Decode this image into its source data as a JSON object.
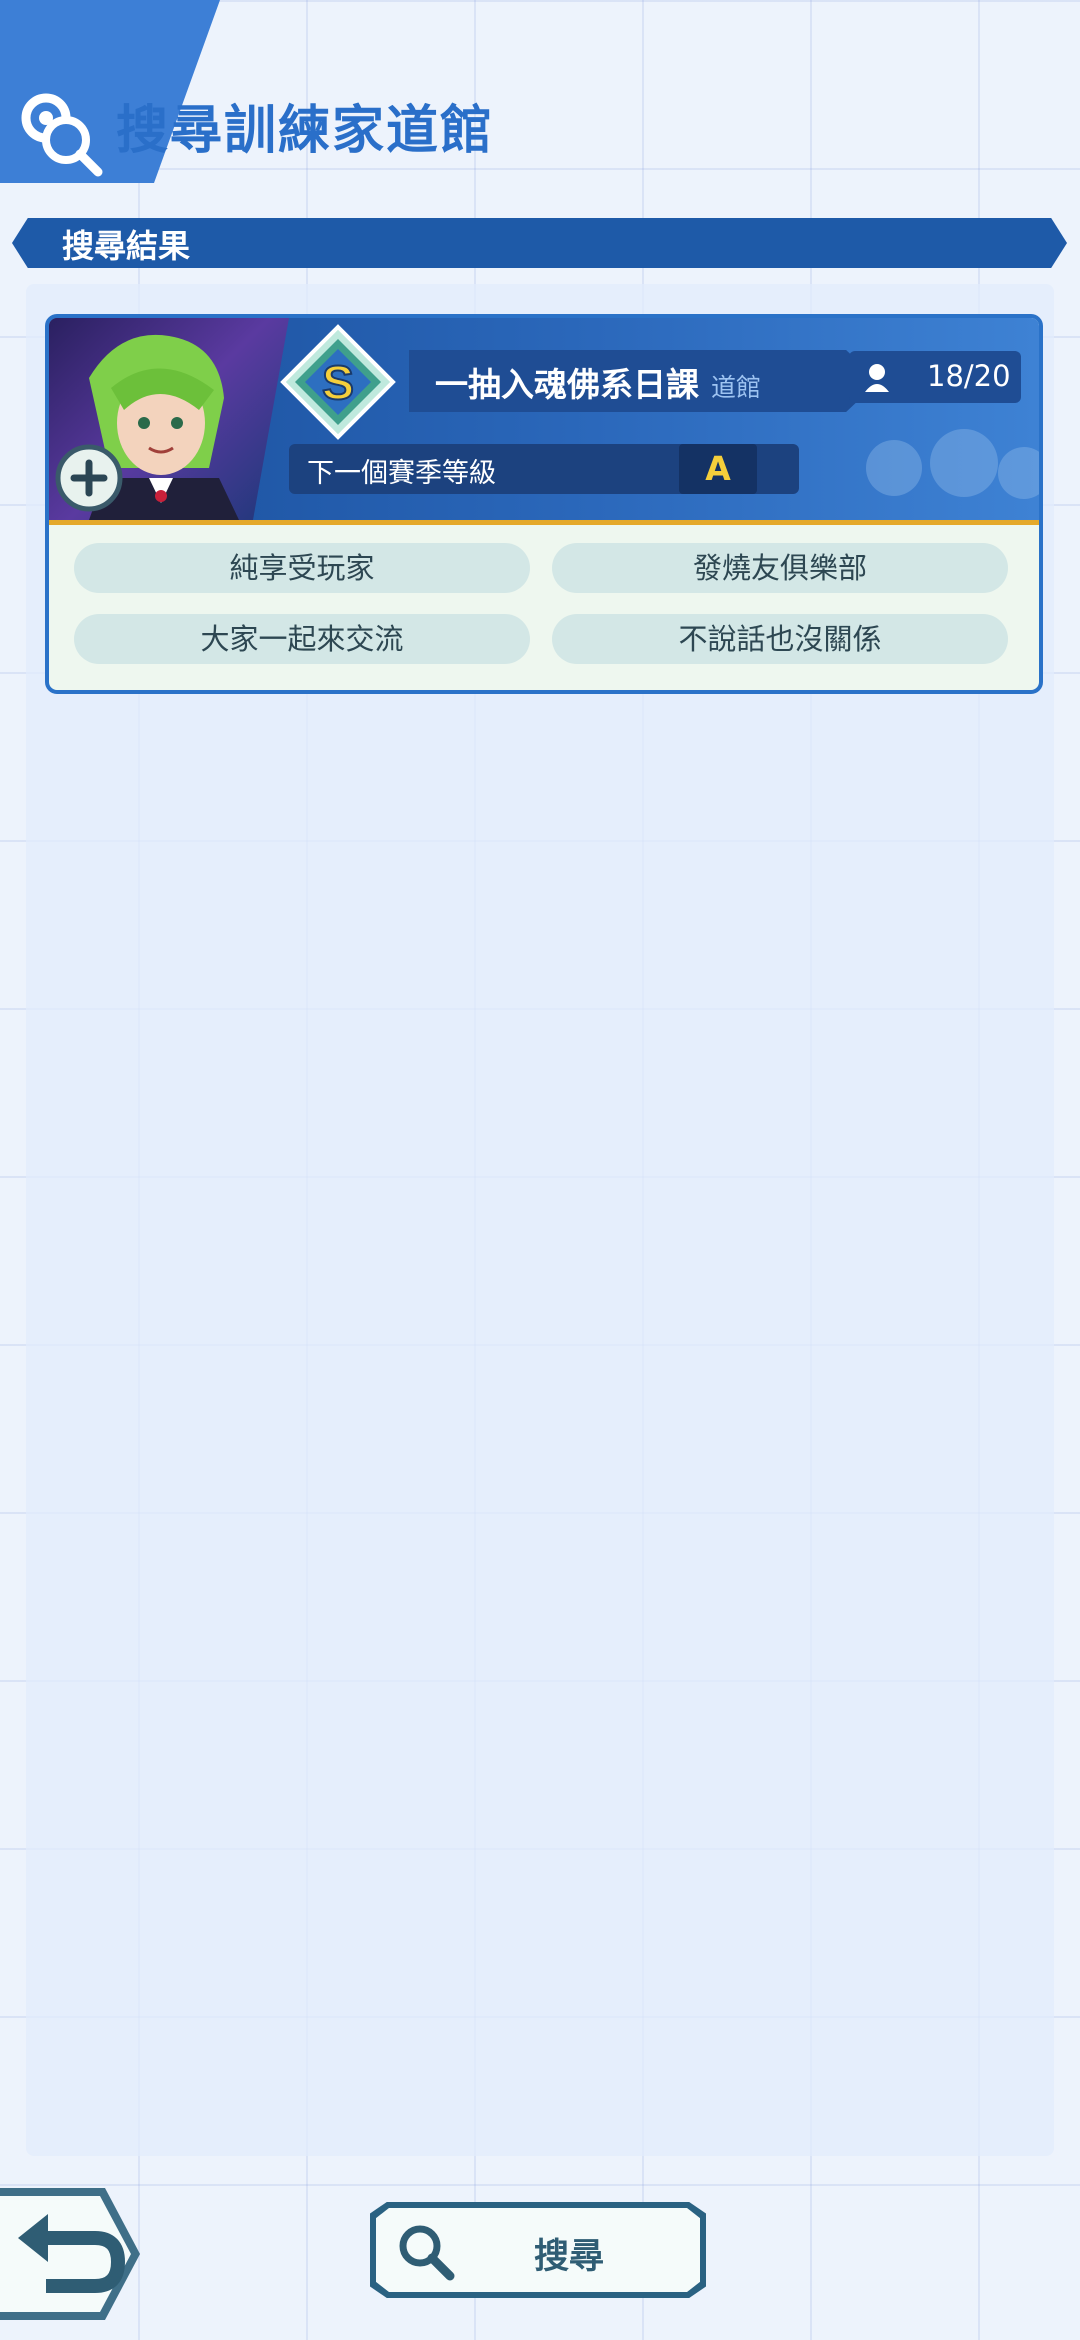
{
  "header": {
    "title": "搜尋訓練家道館",
    "icon": "gym-search-icon"
  },
  "section": {
    "label": "搜尋結果"
  },
  "gym_card": {
    "rank": "S",
    "name": "一抽入魂佛系日課",
    "name_suffix": "道館",
    "members": "18/20",
    "next_season_label": "下一個賽季等級",
    "next_season_grade": "A",
    "tags": [
      "純享受玩家",
      "發燒友俱樂部",
      "大家一起來交流",
      "不說話也沒關係"
    ]
  },
  "footer": {
    "search_label": "搜尋"
  },
  "colors": {
    "accent": "#2a6fc9",
    "banner": "#1e5aa8",
    "grade": "#f5cf3b"
  }
}
